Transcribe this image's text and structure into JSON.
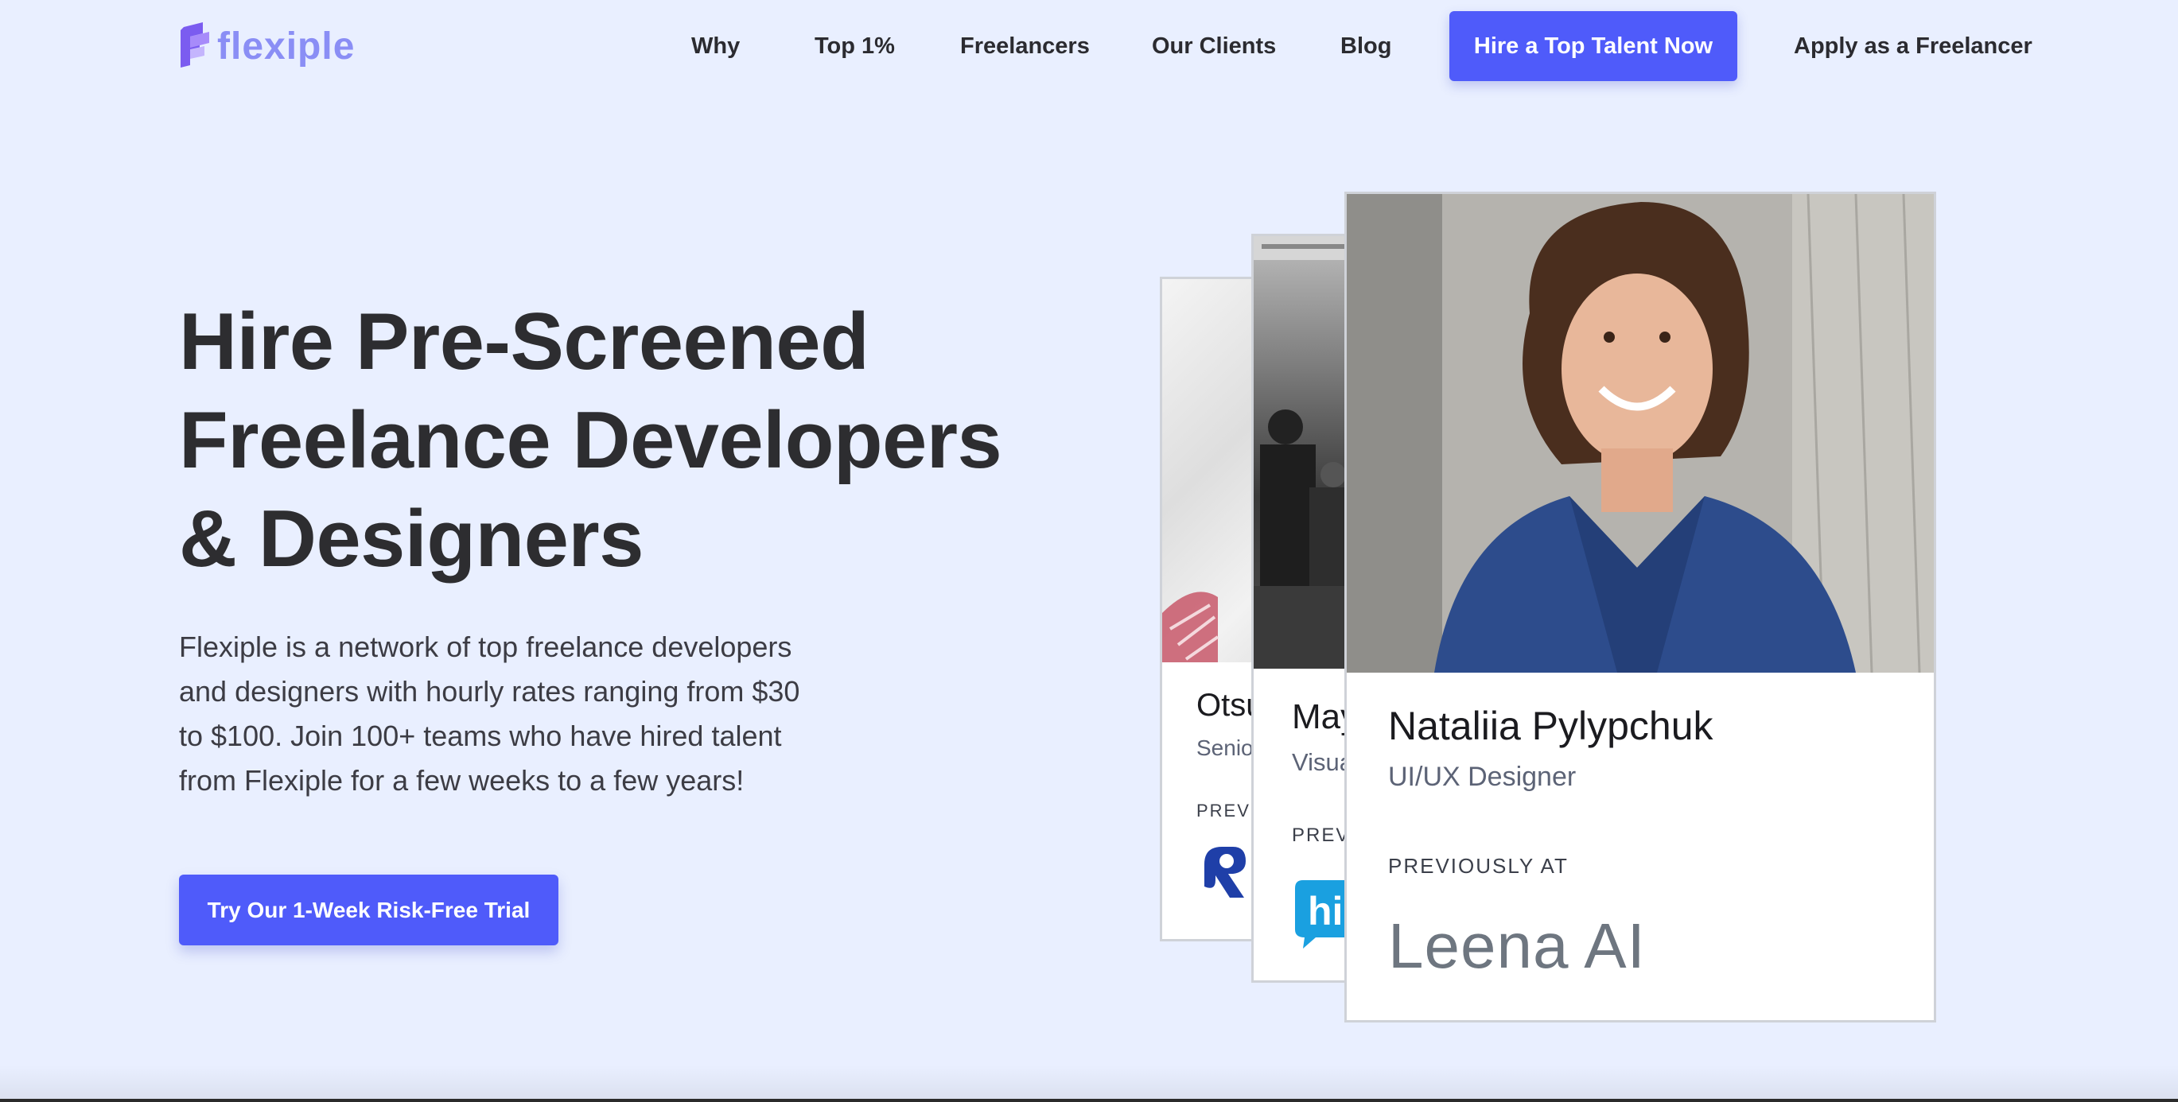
{
  "header": {
    "logo_text": "flexiple",
    "nav": [
      "Why",
      "Top 1%",
      "Freelancers",
      "Our Clients",
      "Blog"
    ],
    "cta": "Hire a Top Talent Now",
    "apply": "Apply as a Freelancer"
  },
  "hero": {
    "title_lines": [
      "Hire Pre-Screened",
      "Freelance Developers",
      "& Designers"
    ],
    "description_lines": [
      "Flexiple is a network of top freelance developers",
      "and designers with hourly rates ranging from $30",
      "to $100. Join 100+ teams who have hired talent",
      "from Flexiple for a few weeks to a few years!"
    ],
    "trial_button": "Try Our 1-Week Risk-Free Trial"
  },
  "cards": [
    {
      "name": "Otsu",
      "role": "Senio",
      "previously": "PREVIC"
    },
    {
      "name": "May",
      "role": "Visua",
      "previously": "PREV"
    },
    {
      "name": "Nataliia Pylypchuk",
      "role": "UI/UX Designer",
      "previously": "PREVIOUSLY AT",
      "company": "Leena AI"
    }
  ],
  "colors": {
    "background": "#e9efff",
    "accent": "#4f5bfa",
    "logo_purple": "#8a8ef5",
    "text_dark": "#2d2d30"
  }
}
